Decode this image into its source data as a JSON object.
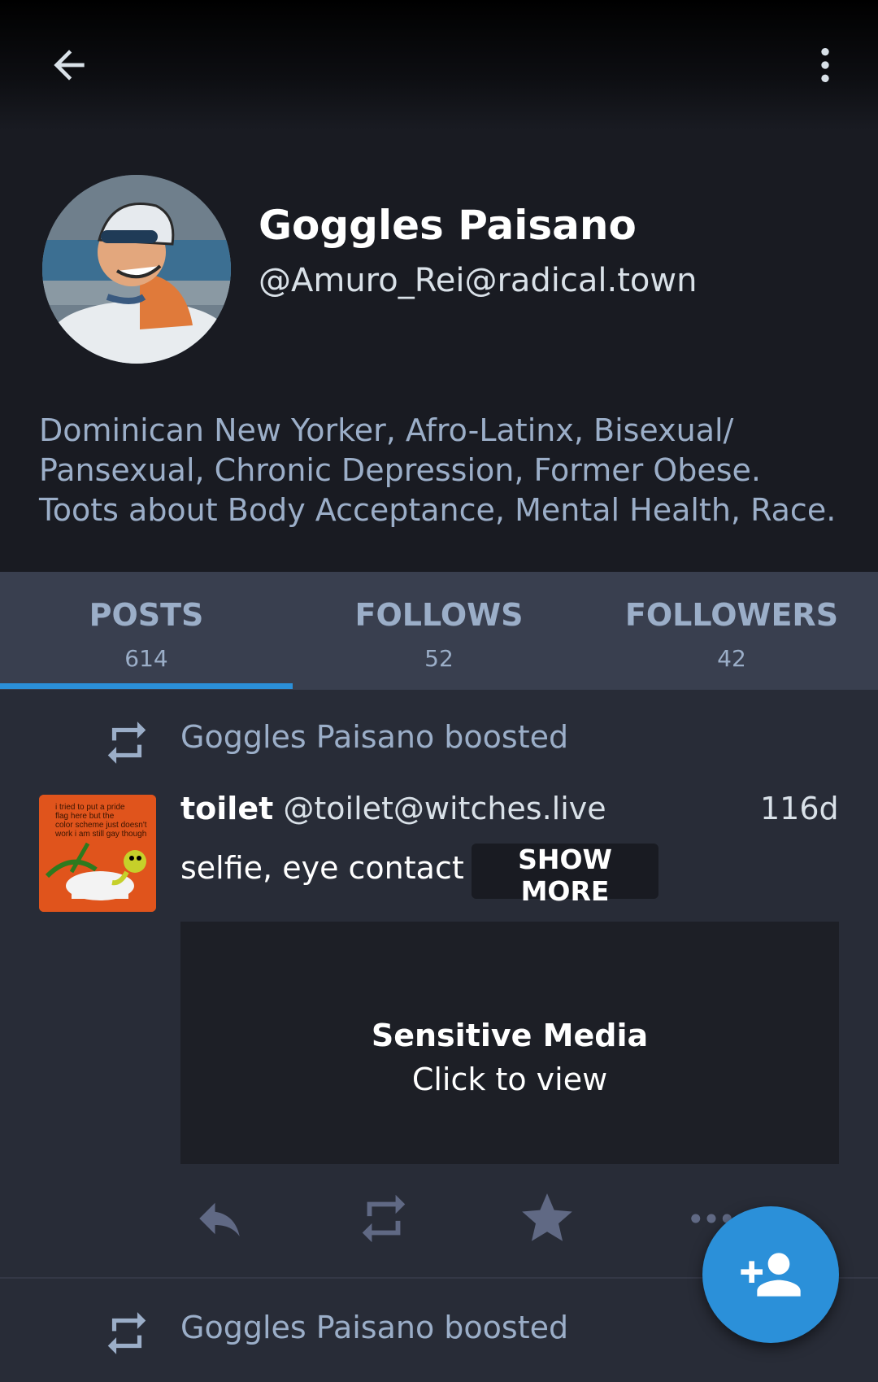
{
  "profile": {
    "display_name": "Goggles Paisano",
    "acct": "@Amuro_Rei@radical.town",
    "bio_lines": [
      "Dominican New Yorker, Afro-Latinx, Bisexual/",
      "Pansexual, Chronic Depression, Former Obese.",
      "Toots about Body Acceptance, Mental Health, Race."
    ]
  },
  "tabs": [
    {
      "label": "POSTS",
      "count": "614"
    },
    {
      "label": "FOLLOWS",
      "count": "52"
    },
    {
      "label": "FOLLOWERS",
      "count": "42"
    }
  ],
  "feed": {
    "boost_label_1": "Goggles Paisano boosted",
    "status": {
      "name": "toilet",
      "acct": "@toilet@witches.live",
      "time": "116d",
      "content_warning": "selfie, eye contact",
      "show_more": "SHOW MORE",
      "avatar_caption": "i tried to put a pride flag here but the color scheme just doesn't work i am still gay though",
      "media_title": "Sensitive Media",
      "media_subtitle": "Click to view"
    },
    "boost_label_2": "Goggles Paisano boosted"
  },
  "icons": {
    "back": "arrow-left-icon",
    "menu": "more-vert-icon",
    "boost": "repeat-icon",
    "reply": "reply-icon",
    "favourite": "star-icon",
    "more": "more-horiz-icon",
    "follow": "person-add-icon"
  },
  "colors": {
    "background": "#282c37",
    "header": "#191b22",
    "tabs": "#393f4f",
    "accent": "#2b90d9",
    "secondary_text": "#9baec8",
    "action_icons": "#606984"
  }
}
